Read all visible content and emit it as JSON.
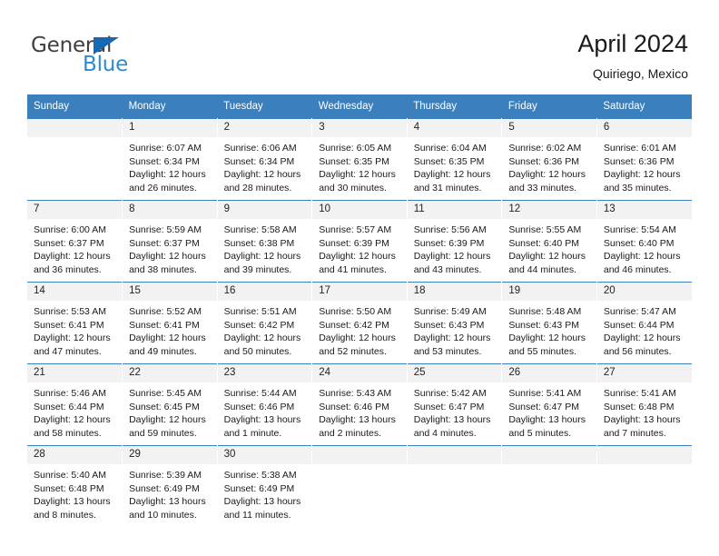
{
  "brand": {
    "name_top": "General",
    "name_bottom": "Blue",
    "color_dark": "#3f3f3f",
    "color_blue": "#2e8bd0",
    "triangle_color": "#1668b3"
  },
  "header": {
    "title": "April 2024",
    "subtitle": "Quiriego, Mexico",
    "accent_color": "#3b7fbd"
  },
  "calendar": {
    "day_headers": [
      "Sunday",
      "Monday",
      "Tuesday",
      "Wednesday",
      "Thursday",
      "Friday",
      "Saturday"
    ],
    "weeks": [
      [
        {
          "day": ""
        },
        {
          "day": "1",
          "sunrise": "Sunrise: 6:07 AM",
          "sunset": "Sunset: 6:34 PM",
          "daylight": "Daylight: 12 hours and 26 minutes."
        },
        {
          "day": "2",
          "sunrise": "Sunrise: 6:06 AM",
          "sunset": "Sunset: 6:34 PM",
          "daylight": "Daylight: 12 hours and 28 minutes."
        },
        {
          "day": "3",
          "sunrise": "Sunrise: 6:05 AM",
          "sunset": "Sunset: 6:35 PM",
          "daylight": "Daylight: 12 hours and 30 minutes."
        },
        {
          "day": "4",
          "sunrise": "Sunrise: 6:04 AM",
          "sunset": "Sunset: 6:35 PM",
          "daylight": "Daylight: 12 hours and 31 minutes."
        },
        {
          "day": "5",
          "sunrise": "Sunrise: 6:02 AM",
          "sunset": "Sunset: 6:36 PM",
          "daylight": "Daylight: 12 hours and 33 minutes."
        },
        {
          "day": "6",
          "sunrise": "Sunrise: 6:01 AM",
          "sunset": "Sunset: 6:36 PM",
          "daylight": "Daylight: 12 hours and 35 minutes."
        }
      ],
      [
        {
          "day": "7",
          "sunrise": "Sunrise: 6:00 AM",
          "sunset": "Sunset: 6:37 PM",
          "daylight": "Daylight: 12 hours and 36 minutes."
        },
        {
          "day": "8",
          "sunrise": "Sunrise: 5:59 AM",
          "sunset": "Sunset: 6:37 PM",
          "daylight": "Daylight: 12 hours and 38 minutes."
        },
        {
          "day": "9",
          "sunrise": "Sunrise: 5:58 AM",
          "sunset": "Sunset: 6:38 PM",
          "daylight": "Daylight: 12 hours and 39 minutes."
        },
        {
          "day": "10",
          "sunrise": "Sunrise: 5:57 AM",
          "sunset": "Sunset: 6:39 PM",
          "daylight": "Daylight: 12 hours and 41 minutes."
        },
        {
          "day": "11",
          "sunrise": "Sunrise: 5:56 AM",
          "sunset": "Sunset: 6:39 PM",
          "daylight": "Daylight: 12 hours and 43 minutes."
        },
        {
          "day": "12",
          "sunrise": "Sunrise: 5:55 AM",
          "sunset": "Sunset: 6:40 PM",
          "daylight": "Daylight: 12 hours and 44 minutes."
        },
        {
          "day": "13",
          "sunrise": "Sunrise: 5:54 AM",
          "sunset": "Sunset: 6:40 PM",
          "daylight": "Daylight: 12 hours and 46 minutes."
        }
      ],
      [
        {
          "day": "14",
          "sunrise": "Sunrise: 5:53 AM",
          "sunset": "Sunset: 6:41 PM",
          "daylight": "Daylight: 12 hours and 47 minutes."
        },
        {
          "day": "15",
          "sunrise": "Sunrise: 5:52 AM",
          "sunset": "Sunset: 6:41 PM",
          "daylight": "Daylight: 12 hours and 49 minutes."
        },
        {
          "day": "16",
          "sunrise": "Sunrise: 5:51 AM",
          "sunset": "Sunset: 6:42 PM",
          "daylight": "Daylight: 12 hours and 50 minutes."
        },
        {
          "day": "17",
          "sunrise": "Sunrise: 5:50 AM",
          "sunset": "Sunset: 6:42 PM",
          "daylight": "Daylight: 12 hours and 52 minutes."
        },
        {
          "day": "18",
          "sunrise": "Sunrise: 5:49 AM",
          "sunset": "Sunset: 6:43 PM",
          "daylight": "Daylight: 12 hours and 53 minutes."
        },
        {
          "day": "19",
          "sunrise": "Sunrise: 5:48 AM",
          "sunset": "Sunset: 6:43 PM",
          "daylight": "Daylight: 12 hours and 55 minutes."
        },
        {
          "day": "20",
          "sunrise": "Sunrise: 5:47 AM",
          "sunset": "Sunset: 6:44 PM",
          "daylight": "Daylight: 12 hours and 56 minutes."
        }
      ],
      [
        {
          "day": "21",
          "sunrise": "Sunrise: 5:46 AM",
          "sunset": "Sunset: 6:44 PM",
          "daylight": "Daylight: 12 hours and 58 minutes."
        },
        {
          "day": "22",
          "sunrise": "Sunrise: 5:45 AM",
          "sunset": "Sunset: 6:45 PM",
          "daylight": "Daylight: 12 hours and 59 minutes."
        },
        {
          "day": "23",
          "sunrise": "Sunrise: 5:44 AM",
          "sunset": "Sunset: 6:46 PM",
          "daylight": "Daylight: 13 hours and 1 minute."
        },
        {
          "day": "24",
          "sunrise": "Sunrise: 5:43 AM",
          "sunset": "Sunset: 6:46 PM",
          "daylight": "Daylight: 13 hours and 2 minutes."
        },
        {
          "day": "25",
          "sunrise": "Sunrise: 5:42 AM",
          "sunset": "Sunset: 6:47 PM",
          "daylight": "Daylight: 13 hours and 4 minutes."
        },
        {
          "day": "26",
          "sunrise": "Sunrise: 5:41 AM",
          "sunset": "Sunset: 6:47 PM",
          "daylight": "Daylight: 13 hours and 5 minutes."
        },
        {
          "day": "27",
          "sunrise": "Sunrise: 5:41 AM",
          "sunset": "Sunset: 6:48 PM",
          "daylight": "Daylight: 13 hours and 7 minutes."
        }
      ],
      [
        {
          "day": "28",
          "sunrise": "Sunrise: 5:40 AM",
          "sunset": "Sunset: 6:48 PM",
          "daylight": "Daylight: 13 hours and 8 minutes."
        },
        {
          "day": "29",
          "sunrise": "Sunrise: 5:39 AM",
          "sunset": "Sunset: 6:49 PM",
          "daylight": "Daylight: 13 hours and 10 minutes."
        },
        {
          "day": "30",
          "sunrise": "Sunrise: 5:38 AM",
          "sunset": "Sunset: 6:49 PM",
          "daylight": "Daylight: 13 hours and 11 minutes."
        },
        {
          "day": ""
        },
        {
          "day": ""
        },
        {
          "day": ""
        },
        {
          "day": ""
        }
      ]
    ]
  }
}
